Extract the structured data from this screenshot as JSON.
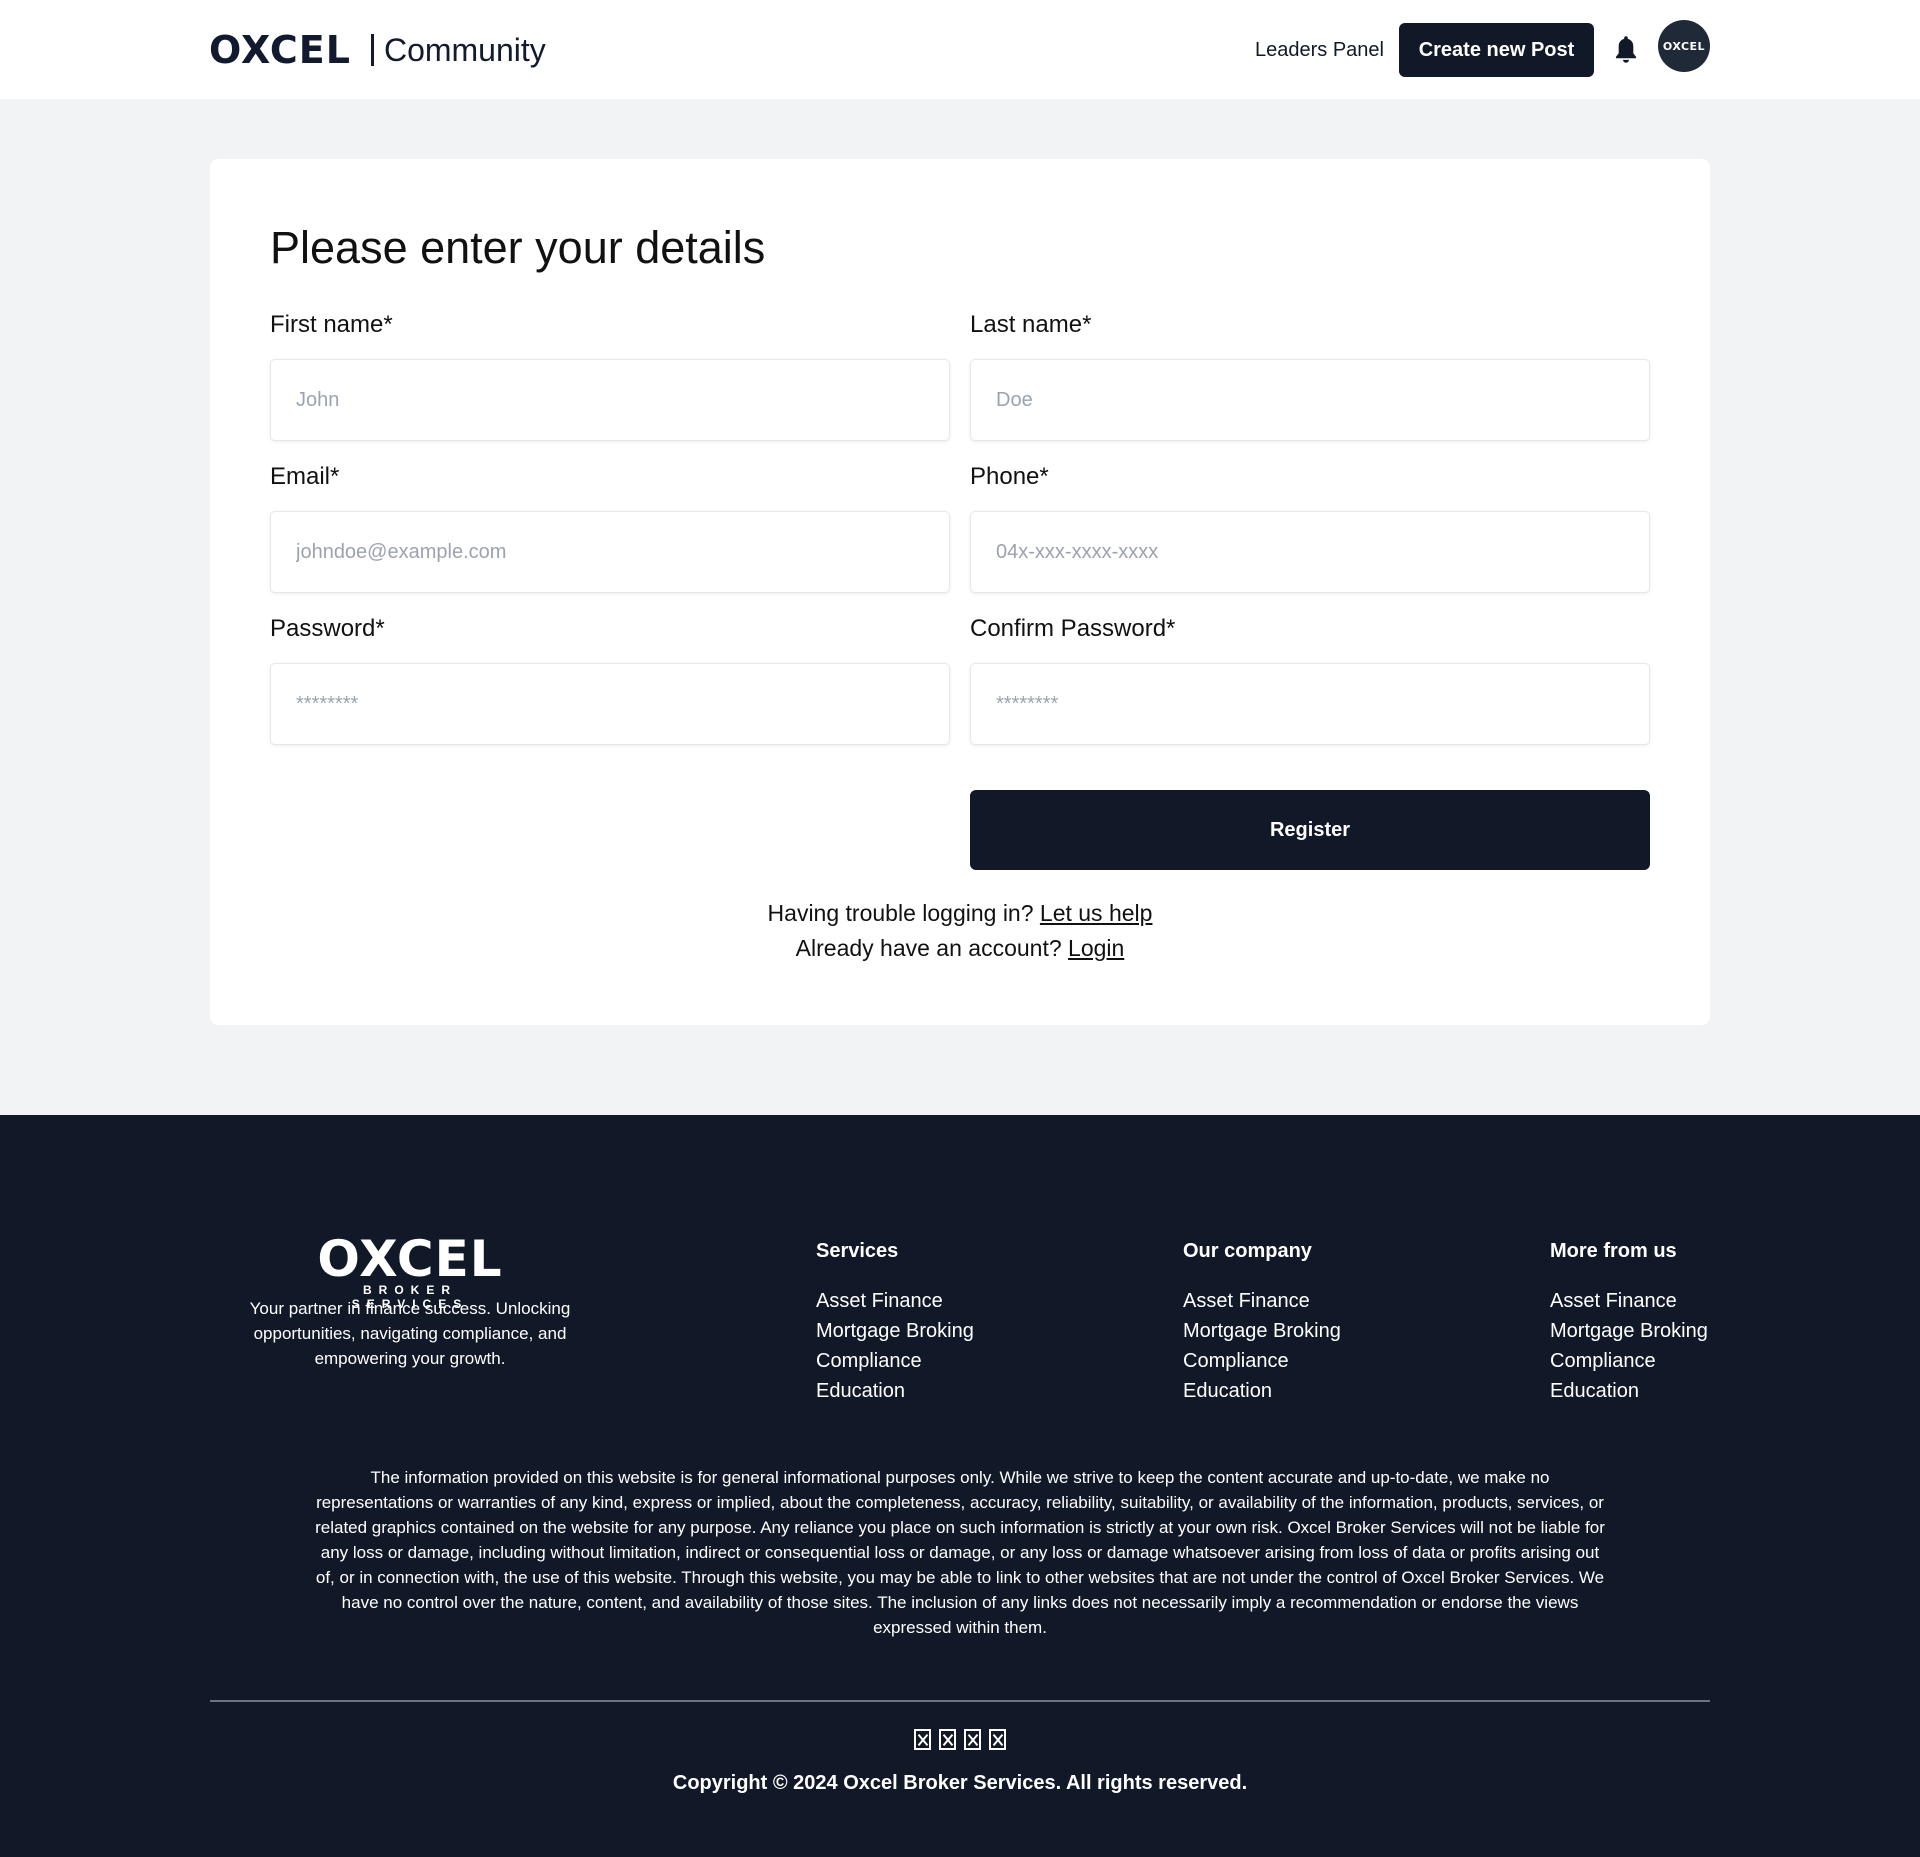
{
  "header": {
    "logo_text": "OXCEL",
    "community_label": "Community",
    "leaders_panel_label": "Leaders Panel",
    "create_post_label": "Create new Post",
    "notification_icon": "bell-icon",
    "avatar_text": "OXCEL"
  },
  "form": {
    "title": "Please enter your details",
    "first_name": {
      "label": "First name*",
      "placeholder": "John",
      "value": ""
    },
    "last_name": {
      "label": "Last name*",
      "placeholder": "Doe",
      "value": ""
    },
    "email": {
      "label": "Email*",
      "placeholder": "johndoe@example.com",
      "value": ""
    },
    "phone": {
      "label": "Phone*",
      "placeholder": "04x-xxx-xxxx-xxxx",
      "value": ""
    },
    "password": {
      "label": "Password*",
      "placeholder": "********",
      "value": ""
    },
    "confirm_password": {
      "label": "Confirm Password*",
      "placeholder": "********",
      "value": ""
    },
    "register_label": "Register",
    "trouble_text": "Having trouble logging in?",
    "trouble_link": "Let us help",
    "account_text": "Already have an account?",
    "login_link": "Login"
  },
  "footer": {
    "logo_text": "OXCEL",
    "logo_subtext": "BROKER SERVICES",
    "tagline": "Your partner in finance success. Unlocking opportunities, navigating compliance, and empowering your growth.",
    "columns": [
      {
        "title": "Services",
        "items": [
          "Asset Finance",
          "Mortgage Broking",
          "Compliance",
          "Education"
        ]
      },
      {
        "title": "Our company",
        "items": [
          "Asset Finance",
          "Mortgage Broking",
          "Compliance",
          "Education"
        ]
      },
      {
        "title": "More from us",
        "items": [
          "Asset Finance",
          "Mortgage Broking",
          "Compliance",
          "Education"
        ]
      }
    ],
    "disclaimer": "The information provided on this website is for general informational purposes only. While we strive to keep the content accurate and up-to-date, we make no representations or warranties of any kind, express or implied, about the completeness, accuracy, reliability, suitability, or availability of the information, products, services, or related graphics contained on the website for any purpose. Any reliance you place on such information is strictly at your own risk. Oxcel Broker Services will not be liable for any loss or damage, including without limitation, indirect or consequential loss or damage, or any loss or damage whatsoever arising from loss of data or profits arising out of, or in connection with, the use of this website. Through this website, you may be able to link to other websites that are not under the control of Oxcel Broker Services. We have no control over the nature, content, and availability of those sites. The inclusion of any links does not necessarily imply a recommendation or endorse the views expressed within them.",
    "social_icons": [
      "social-icon-1",
      "social-icon-2",
      "social-icon-3",
      "social-icon-4"
    ],
    "copyright": "Copyright © 2024 Oxcel Broker Services. All rights reserved."
  }
}
